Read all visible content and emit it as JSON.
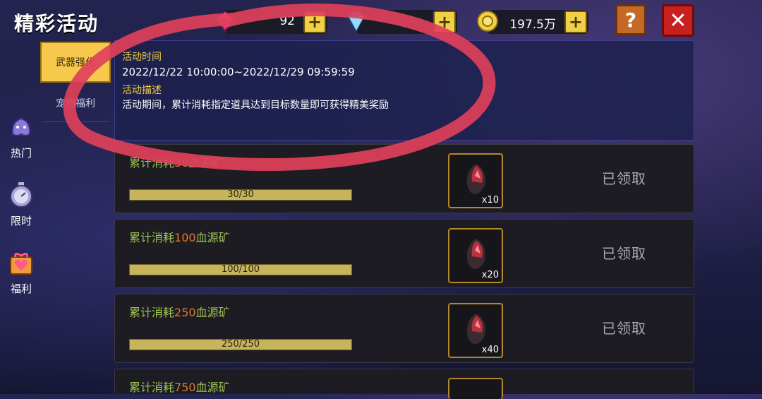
{
  "header": {
    "title": "精彩活动",
    "resources": [
      {
        "icon": "pink-gem-icon",
        "value": "92"
      },
      {
        "icon": "diamond-icon",
        "value": ""
      },
      {
        "icon": "gold-coin-icon",
        "value": "197.5万"
      }
    ],
    "help_label": "?",
    "close_label": "✕"
  },
  "sidebar": {
    "items": [
      {
        "label": "热门",
        "icon": "hot-ghost-icon"
      },
      {
        "label": "限时",
        "icon": "stopwatch-icon"
      },
      {
        "label": "福利",
        "icon": "gift-heart-icon"
      }
    ],
    "subtabs": [
      {
        "label": "武器强化",
        "active": true
      },
      {
        "label": "宠物福利",
        "active": false
      }
    ]
  },
  "info": {
    "time_label": "活动时间",
    "time_value": "2022/12/22 10:00:00~2022/12/29 09:59:59",
    "desc_label": "活动描述",
    "desc_value": "活动期间，累计消耗指定道具达到目标数量即可获得精美奖励"
  },
  "tasks": [
    {
      "prefix": "累计消耗",
      "num": "30",
      "suffix": "血源矿",
      "progress": "30/30",
      "ratio": 1.0,
      "reward_count": "x10",
      "status": "已领取"
    },
    {
      "prefix": "累计消耗",
      "num": "100",
      "suffix": "血源矿",
      "progress": "100/100",
      "ratio": 1.0,
      "reward_count": "x20",
      "status": "已领取"
    },
    {
      "prefix": "累计消耗",
      "num": "250",
      "suffix": "血源矿",
      "progress": "250/250",
      "ratio": 1.0,
      "reward_count": "x40",
      "status": "已领取"
    },
    {
      "prefix": "累计消耗",
      "num": "750",
      "suffix": "血源矿",
      "progress": "",
      "ratio": 1.0,
      "reward_count": "",
      "status": ""
    }
  ],
  "colors": {
    "accent_gold": "#f2d046",
    "task_name_green": "#9cc254",
    "task_num_orange": "#e07a28",
    "annotation_red": "#e0405a"
  }
}
